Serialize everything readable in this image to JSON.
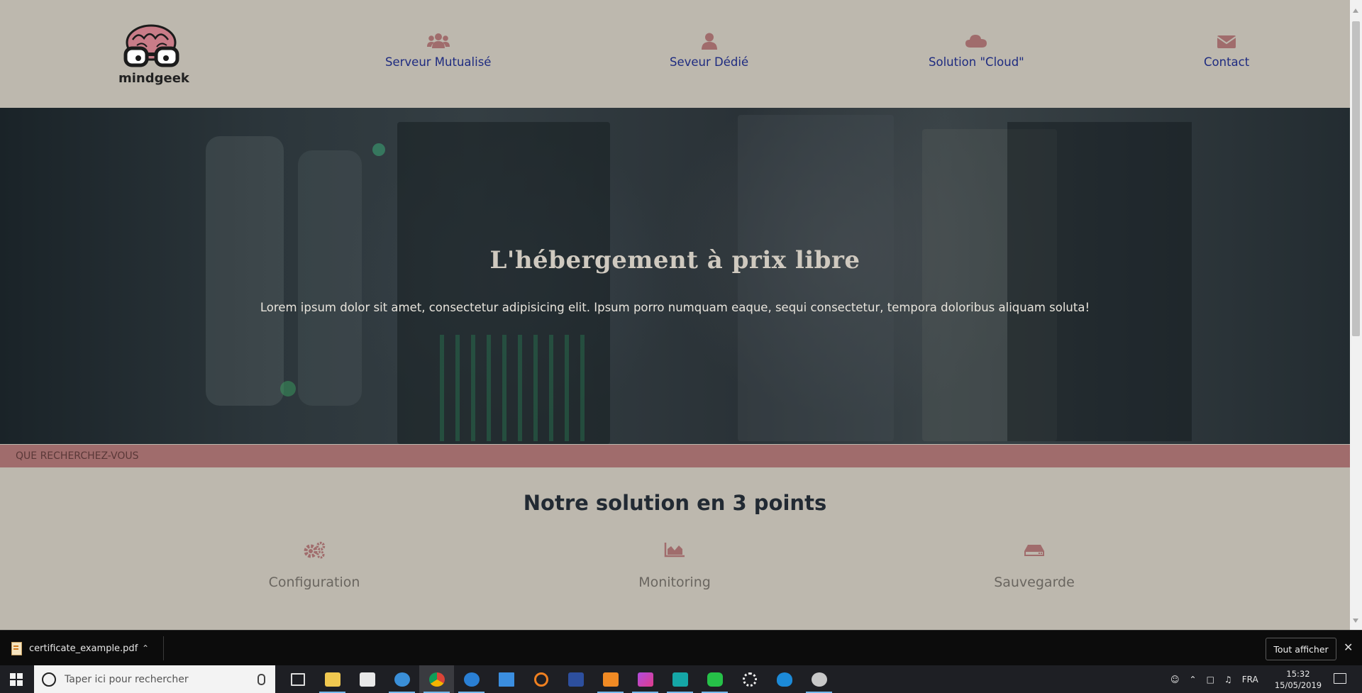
{
  "colors": {
    "page_bg": "#bdb8ae",
    "nav_text": "#1e2b80",
    "accent_icon": "#a06c6c",
    "search_bar_bg": "#a06c6c",
    "hero_title": "#cfc9bf"
  },
  "header": {
    "logo_text": "mindgeek",
    "nav": [
      {
        "label": "Serveur Mutualisé",
        "icon": "users-icon"
      },
      {
        "label": "Seveur Dédié",
        "icon": "user-icon"
      },
      {
        "label": "Solution \"Cloud\"",
        "icon": "cloud-icon"
      },
      {
        "label": "Contact",
        "icon": "envelope-icon"
      }
    ]
  },
  "hero": {
    "title": "L'hébergement à prix libre",
    "subtitle": "Lorem ipsum dolor sit amet, consectetur adipisicing elit. Ipsum porro numquam eaque, sequi consectetur, tempora doloribus aliquam soluta!"
  },
  "search": {
    "placeholder": "QUE RECHERCHEZ-VOUS"
  },
  "features": {
    "title": "Notre solution en 3 points",
    "items": [
      {
        "label": "Configuration",
        "icon": "cogs-icon"
      },
      {
        "label": "Monitoring",
        "icon": "area-chart-icon"
      },
      {
        "label": "Sauvegarde",
        "icon": "hdd-icon"
      }
    ]
  },
  "download_bar": {
    "file_name": "certificate_example.pdf",
    "show_all": "Tout afficher"
  },
  "taskbar": {
    "search_placeholder": "Taper ici pour rechercher",
    "apps": [
      "task-view-icon",
      "file-explorer-icon",
      "store-icon",
      "browser-icon",
      "chrome-icon",
      "vpn-icon",
      "window-icon",
      "search-tool-icon",
      "powershell-icon",
      "sublime-icon",
      "phpstorm-icon",
      "arduino-icon",
      "line-icon",
      "settings-icon",
      "mysql-icon",
      "paint-icon"
    ],
    "language": "FRA",
    "time": "15:32",
    "date": "15/05/2019"
  }
}
